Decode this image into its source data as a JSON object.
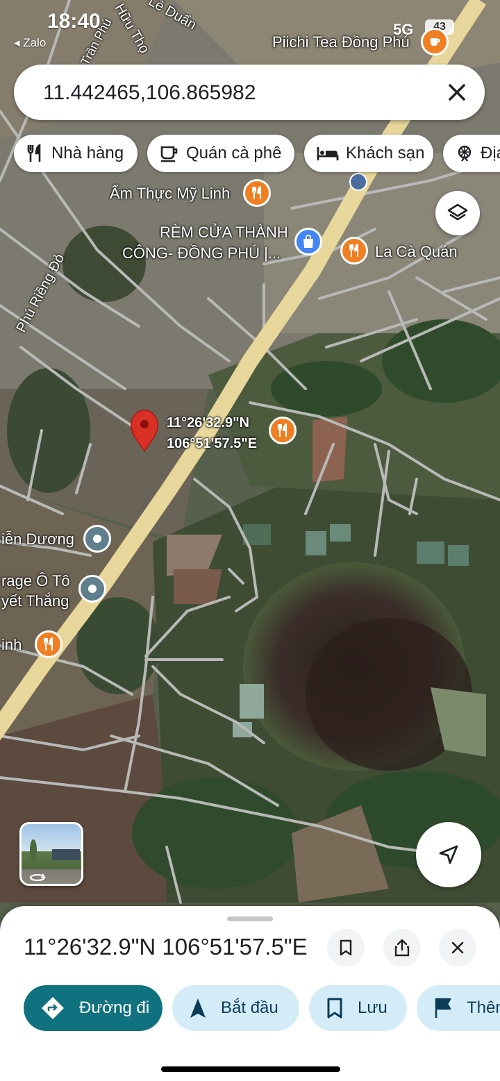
{
  "status_bar": {
    "time": "18:40",
    "back_app": "◂ Zalo",
    "network": "5G",
    "battery": "43"
  },
  "search": {
    "value": "11.442465,106.865982",
    "close_icon": "close-icon"
  },
  "chips": [
    {
      "label": "Nhà hàng",
      "icon": "restaurant-icon"
    },
    {
      "label": "Quán cà phê",
      "icon": "coffee-icon"
    },
    {
      "label": "Khách sạn",
      "icon": "hotel-icon"
    },
    {
      "label": "Địa",
      "icon": "attraction-icon"
    }
  ],
  "map_labels": {
    "streets": [
      "Phú Riềng Đỏ",
      "Trần Phú",
      "Lê Duẩn",
      "Hữu Thọ"
    ],
    "pois": [
      {
        "name": "Piichi Tea Đồng Phú",
        "icon": "cup-icon"
      },
      {
        "name": "Ẩm Thực Mỹ Linh",
        "icon": "restaurant-icon"
      },
      {
        "name": "RÈM CỬA THÀNH",
        "name2": "CÔNG- ĐỒNG PHÚ |...",
        "icon": "shopping-bag-icon"
      },
      {
        "name": "La Cà Quán",
        "icon": "restaurant-icon"
      },
      {
        "name": "iễn Dương",
        "icon": "place-icon"
      },
      {
        "name": "rage Ô Tô",
        "name2": "yết Thắng",
        "icon": "place-icon"
      },
      {
        "name": "inh",
        "icon": "restaurant-icon"
      }
    ],
    "pin": {
      "lat": "11°26'32.9\"N",
      "lng": "106°51'57.5\"E"
    }
  },
  "sheet": {
    "title": "11°26'32.9\"N 106°51'57.5\"E",
    "actions": [
      {
        "label": "Đường đi",
        "icon": "directions-icon",
        "primary": true
      },
      {
        "label": "Bắt đầu",
        "icon": "navigation-arrow-icon"
      },
      {
        "label": "Lưu",
        "icon": "bookmark-icon"
      },
      {
        "label": "Thêm",
        "icon": "flag-icon"
      }
    ]
  },
  "colors": {
    "accent": "#10717f",
    "chip_tint": "#d3ecf8",
    "poi_orange": "#f07f24",
    "pin_red": "#d93025",
    "road": "#e8d79a"
  }
}
